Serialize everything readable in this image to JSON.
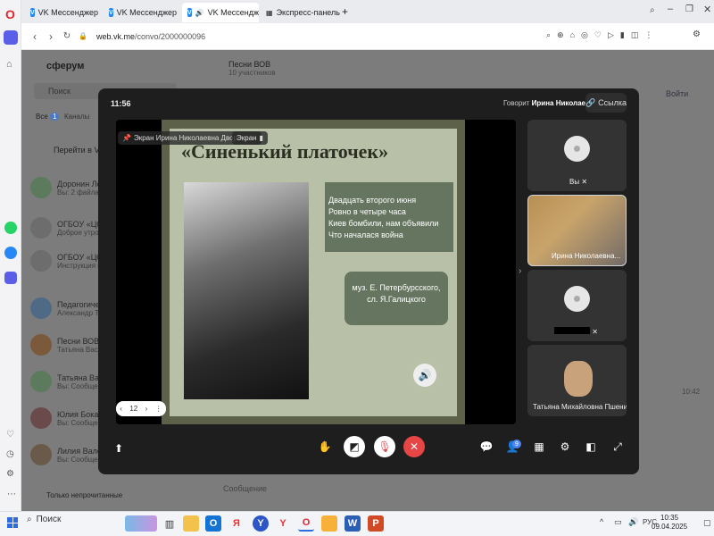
{
  "browser": {
    "tabs": [
      {
        "label": "VK Мессенджер"
      },
      {
        "label": "VK Мессенджер"
      },
      {
        "label": "VK Мессенджер"
      },
      {
        "label": "Экспресс-панель"
      }
    ],
    "url_host": "web.vk.me",
    "url_path": "/convo/2000000096"
  },
  "vk": {
    "logo": "сферум",
    "search_placeholder": "Поиск",
    "tab_all": "Все",
    "tab_all_count": "1",
    "tab_channels": "Каналы",
    "go_to_vk": "Перейти в VK М",
    "chat_header_title": "Песни ВОВ",
    "chat_header_sub": "10 участников",
    "join_btn": "Войти",
    "msg_time": "10:42",
    "composer_placeholder": "Сообщение",
    "unread_only": "Только непрочитанные",
    "chats": [
      {
        "name": "Доронин Леон",
        "sub": "Вы: 2 файла"
      },
      {
        "name": "ОГБОУ «ЦОДТ",
        "sub": "Доброе утро, ув"
      },
      {
        "name": "ОГБОУ «ЦОДТ",
        "sub": "Инструкция по"
      },
      {
        "name": "Педагогически",
        "sub": "Александр Тур"
      },
      {
        "name": "Песни ВОВ",
        "sub": "Татьяна Васил"
      },
      {
        "name": "Татьяна Васил",
        "sub": "Вы: Сообщени"
      },
      {
        "name": "Юлия Боканов",
        "sub": "Вы: Сообщени"
      },
      {
        "name": "Лилия Валерь",
        "sub": "Вы: Сообщени"
      }
    ]
  },
  "call": {
    "time": "11:56",
    "speaking_label": "Говорит",
    "speaker_name": "Ирина Николаевна Д.",
    "link_btn": "Ссылка",
    "screen_owner_label": "Экран Ирина Николаевна Дворецкая",
    "screen_label": "Экран",
    "page_number": "12",
    "slide": {
      "title": "«Синенький платочек»",
      "lyrics": [
        "Двадцать второго июня",
        "Ровно в четыре часа",
        "Киев бомбили, нам объявили",
        "Что началася война"
      ],
      "credits": [
        "муз. Е. Петербурсского,",
        "сл. Я.Галицкого"
      ]
    },
    "participants": [
      {
        "name": "Вы"
      },
      {
        "name": "Ирина Николаевна..."
      },
      {
        "name": ""
      },
      {
        "name": "Татьяна Михайловна Пшенина"
      }
    ],
    "participants_badge": "9"
  },
  "taskbar": {
    "search": "Поиск",
    "lang": "РУС",
    "time": "10:35",
    "date": "09.04.2025"
  },
  "colors": {
    "hangup": "#e64646",
    "vk_blue": "#2787f5",
    "slide_bg": "#b9c0a8",
    "slide_box": "#667560"
  }
}
